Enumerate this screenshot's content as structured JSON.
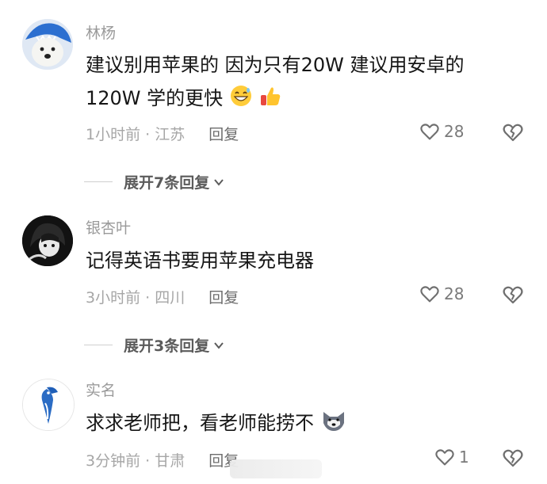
{
  "comments": [
    {
      "username": "林杨",
      "text_line1": "建议别用苹果的 因为只有20W 建议用安卓的",
      "text_line2": "120W 学的更快",
      "meta": "1小时前 · 江苏",
      "reply_label": "回复",
      "likes": "28",
      "expand_label": "展开7条回复"
    },
    {
      "username": "银杏叶",
      "text_line1": "记得英语书要用苹果充电器",
      "meta": "3小时前 · 四川",
      "reply_label": "回复",
      "likes": "28",
      "expand_label": "展开3条回复"
    },
    {
      "username": "实名",
      "text_line1": "求求老师把，看老师能捞不",
      "meta": "3分钟前 · 甘肃",
      "reply_label": "回复",
      "likes": "1"
    }
  ],
  "icons": {
    "like": "heart-outline-icon",
    "dislike": "broken-heart-icon",
    "expand": "chevron-down-icon",
    "emoji1": "grinning-sweat-emoji",
    "emoji2": "thumbs-up-emoji",
    "emoji3": "wolf-face-emoji"
  },
  "colors": {
    "text": "#161616",
    "muted": "#a6a6a6",
    "expand": "#5b5b5b",
    "avatar1": "#2c6fd0"
  }
}
